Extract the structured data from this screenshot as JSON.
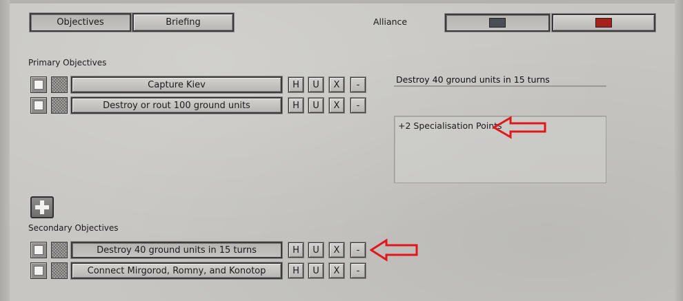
{
  "tabs": [
    {
      "label": "Objectives",
      "active": true
    },
    {
      "label": "Briefing",
      "active": false
    }
  ],
  "alliance": {
    "label": "Alliance",
    "colors": [
      "#4a4f57",
      "#a8201a"
    ]
  },
  "primary": {
    "heading": "Primary Objectives",
    "rows": [
      {
        "title": "Capture Kiev",
        "buttons": [
          "H",
          "U",
          "X",
          "-"
        ]
      },
      {
        "title": "Destroy or rout 100 ground units",
        "buttons": [
          "H",
          "U",
          "X",
          "-"
        ]
      }
    ]
  },
  "secondary": {
    "heading": "Secondary Objectives",
    "rows": [
      {
        "title": "Destroy 40 ground units in 15 turns",
        "buttons": [
          "H",
          "U",
          "X",
          "-"
        ]
      },
      {
        "title": "Connect Mirgorod, Romny, and Konotop",
        "buttons": [
          "H",
          "U",
          "X",
          "-"
        ]
      }
    ]
  },
  "detail": {
    "name_value": "Destroy 40 ground units in 15 turns",
    "reward_text": "+2 Specialisation Points"
  },
  "add_button_icon": "plus-icon",
  "annotation_arrow_color": "#e0171b"
}
